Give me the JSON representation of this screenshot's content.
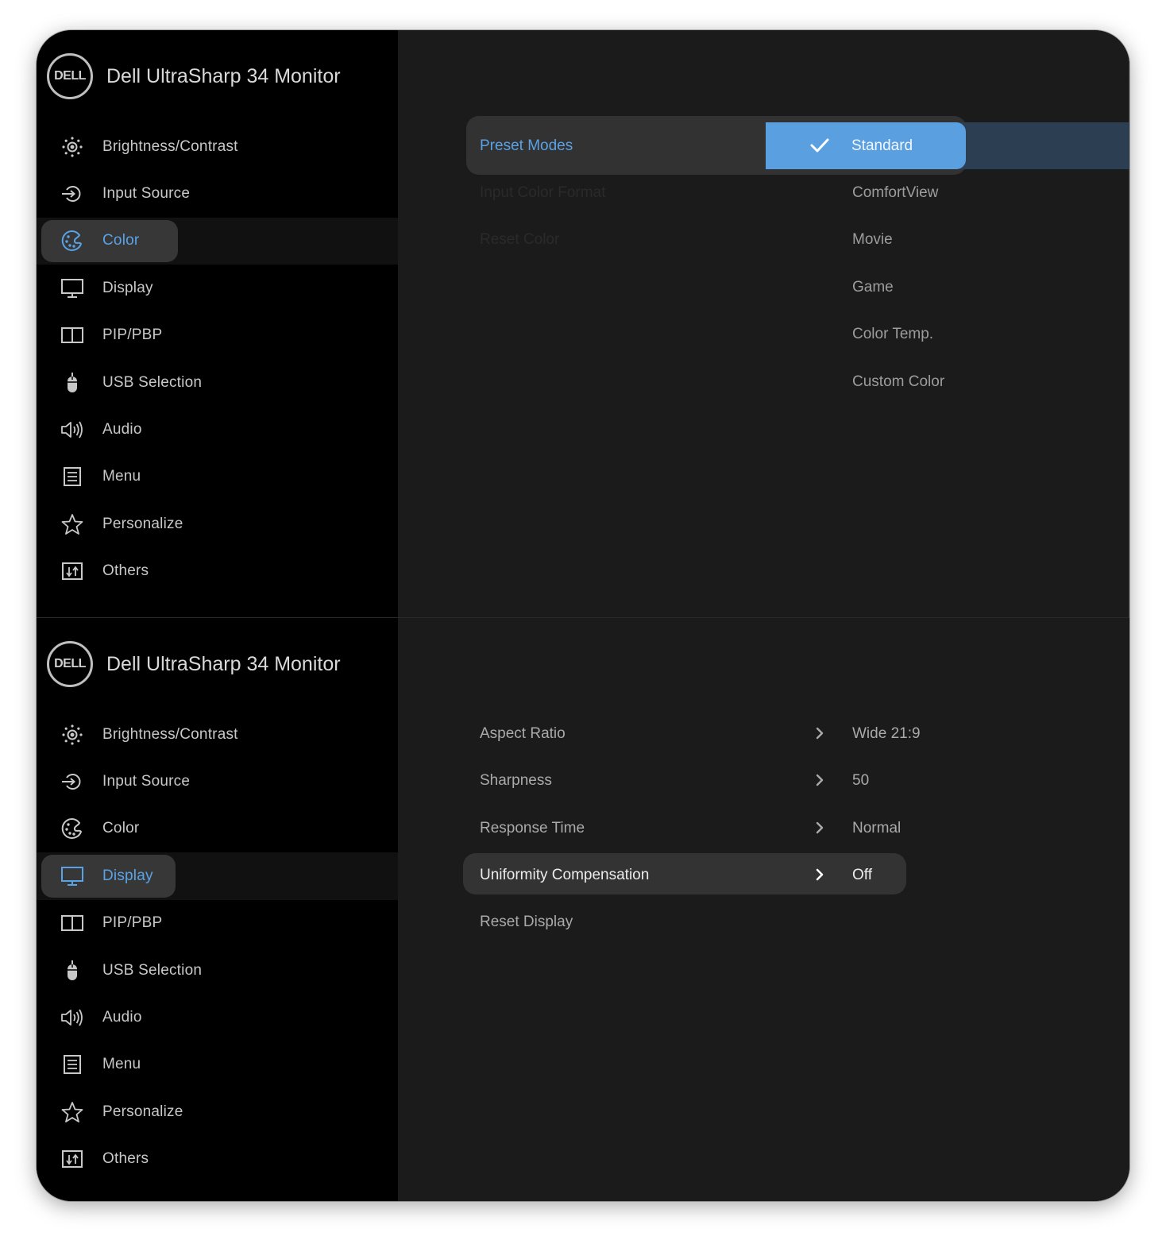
{
  "brand": {
    "logo": "DELL",
    "title": "Dell UltraSharp 34 Monitor"
  },
  "nav": [
    {
      "label": "Brightness/Contrast",
      "icon": "brightness-icon"
    },
    {
      "label": "Input Source",
      "icon": "input-source-icon"
    },
    {
      "label": "Color",
      "icon": "palette-icon"
    },
    {
      "label": "Display",
      "icon": "monitor-icon"
    },
    {
      "label": "PIP/PBP",
      "icon": "pip-icon"
    },
    {
      "label": "USB Selection",
      "icon": "mouse-icon"
    },
    {
      "label": "Audio",
      "icon": "speaker-icon"
    },
    {
      "label": "Menu",
      "icon": "menu-icon"
    },
    {
      "label": "Personalize",
      "icon": "star-icon"
    },
    {
      "label": "Others",
      "icon": "others-icon"
    }
  ],
  "top_panel": {
    "active_nav": "Color",
    "rows": [
      {
        "label": "Preset Modes",
        "selected": "Standard"
      },
      {
        "label": "Input Color Format"
      },
      {
        "label": "Reset Color"
      }
    ],
    "options": [
      "Standard",
      "ComfortView",
      "Movie",
      "Game",
      "Color Temp.",
      "Custom Color"
    ]
  },
  "bottom_panel": {
    "active_nav": "Display",
    "rows": [
      {
        "label": "Aspect Ratio",
        "value": "Wide 21:9"
      },
      {
        "label": "Sharpness",
        "value": "50"
      },
      {
        "label": "Response Time",
        "value": "Normal"
      },
      {
        "label": "Uniformity Compensation",
        "value": "Off"
      },
      {
        "label": "Reset Display",
        "value": ""
      }
    ]
  },
  "colors": {
    "accent": "#5aa2e6",
    "selected_fill": "#5a9fe0",
    "sidebar_bg": "#000000",
    "content_bg": "#1b1b1b",
    "highlight": "#333333"
  }
}
